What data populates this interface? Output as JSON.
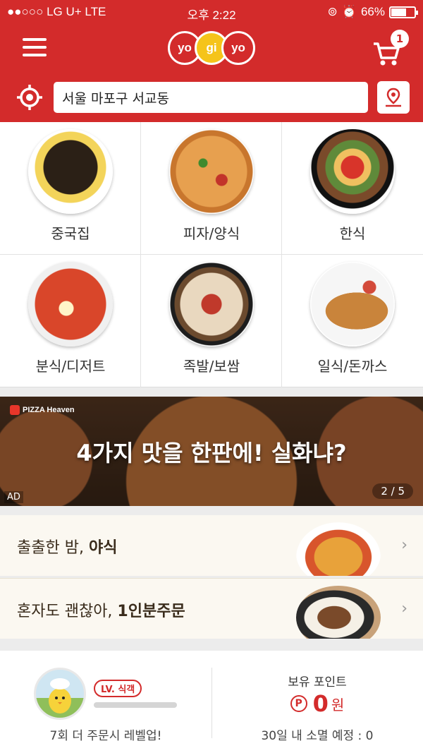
{
  "status_bar": {
    "carrier": "●●○○○ LG U+  LTE",
    "time": "오후 2:22",
    "battery": "66%",
    "battery_level": 0.66
  },
  "header": {
    "logo": [
      "yo",
      "gi",
      "yo"
    ],
    "cart_count": "1",
    "address": "서울 마포구 서교동"
  },
  "categories": [
    {
      "label": "중국집",
      "icon": "jajangmyeon-icon"
    },
    {
      "label": "피자/양식",
      "icon": "pizza-icon"
    },
    {
      "label": "한식",
      "icon": "bibimbap-icon"
    },
    {
      "label": "분식/디저트",
      "icon": "tteokbokki-icon"
    },
    {
      "label": "족발/보쌈",
      "icon": "jokbal-icon"
    },
    {
      "label": "일식/돈까스",
      "icon": "tonkatsu-icon"
    }
  ],
  "banner": {
    "brand": "PIZZA Heaven",
    "headline": "4가지 맛을 한판에! 실화냐?",
    "ad_label": "AD",
    "pager": "2 / 5"
  },
  "themes": [
    {
      "title_normal": "출출한 밤, ",
      "title_bold": "야식"
    },
    {
      "title_normal": "혼자도 괜찮아, ",
      "title_bold": "1인분주문"
    }
  ],
  "footer": {
    "level_badge": "LV. 식객",
    "level_progress": 0.0,
    "levelup_text": "7회 더 주문시 레벨업!",
    "points_title": "보유 포인트",
    "points_symbol": "P",
    "points_value": "0",
    "points_unit": "원",
    "expire_text": "30일 내 소멸 예정 : 0"
  },
  "colors": {
    "brand_red": "#d32b2b",
    "logo_yellow": "#f5c41a"
  }
}
